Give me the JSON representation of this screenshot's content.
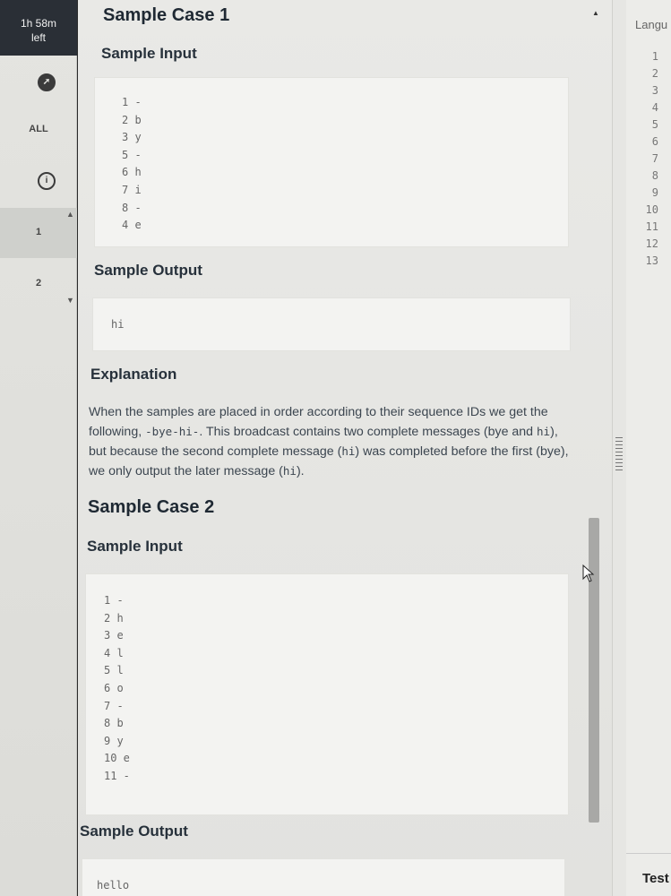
{
  "timer": {
    "line1": "1h 58m",
    "line2": "left"
  },
  "rail": {
    "all_label": "ALL",
    "items": [
      "1",
      "2"
    ]
  },
  "sample1": {
    "title": "Sample Case 1",
    "input_heading": "Sample Input",
    "input_lines": [
      "1 -",
      "2 b",
      "3 y",
      "5 -",
      "6 h",
      "7 i",
      "8 -",
      "4 e"
    ],
    "output_heading": "Sample Output",
    "output": "hi"
  },
  "explanation": {
    "heading": "Explanation",
    "p1": "When the samples are placed in order according to their sequence IDs we get the following,",
    "code1": "-bye-hi-",
    "p2": ". This broadcast contains two complete messages (bye and",
    "code2": "hi",
    "p3": "), but because the second complete message (",
    "code3": "hi",
    "p4": ") was completed before the first (bye), we only output the later message (",
    "code4": "hi",
    "p5": ")."
  },
  "sample2": {
    "title": "Sample Case 2",
    "input_heading": "Sample Input",
    "input_lines": [
      "1 -",
      "2 h",
      "3 e",
      "4 l",
      "5 l",
      "6 o",
      "7 -",
      "8 b",
      "9 y",
      "10 e",
      "11 -"
    ],
    "output_heading": "Sample Output",
    "output": "hello"
  },
  "editor": {
    "language_label": "Langu",
    "line_numbers": [
      "1",
      "2",
      "3",
      "4",
      "5",
      "6",
      "7",
      "8",
      "9",
      "10",
      "11",
      "12",
      "13"
    ],
    "test_label": "Test"
  }
}
